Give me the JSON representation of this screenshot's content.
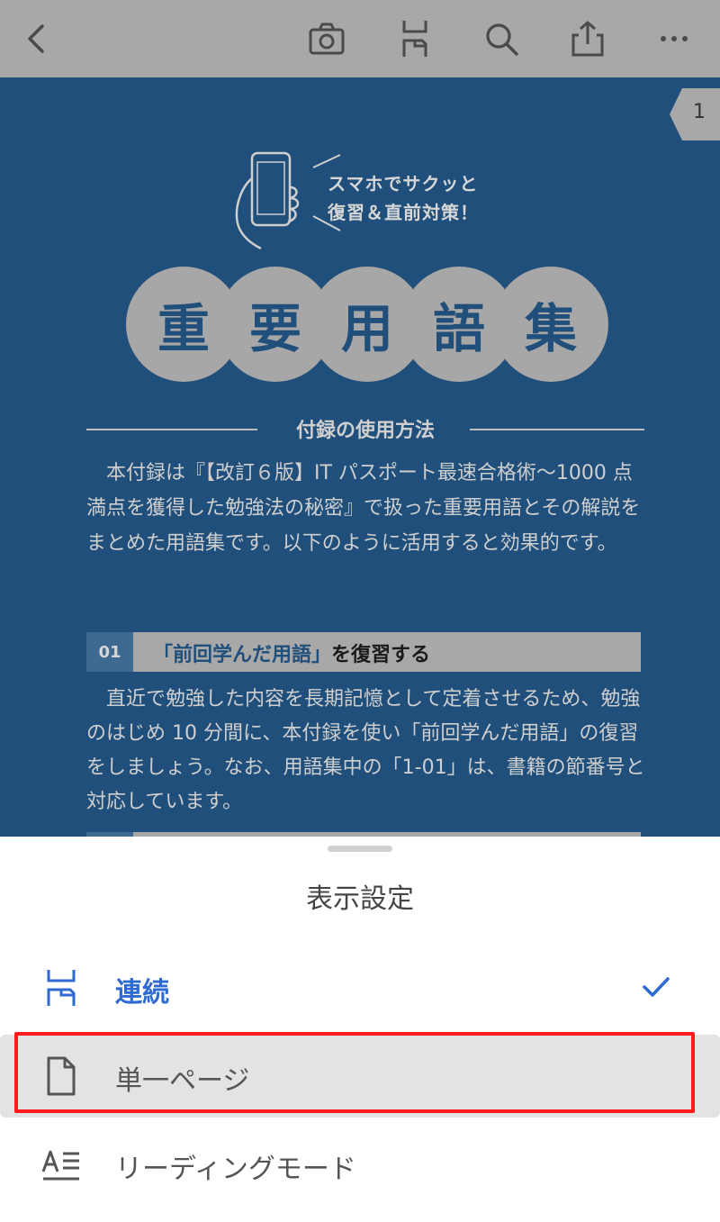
{
  "toolbar": {
    "back_icon": "chevron-left-icon",
    "camera_icon": "camera-icon",
    "scroll_mode_icon": "continuous-scroll-icon",
    "search_icon": "search-icon",
    "share_icon": "share-icon",
    "more_icon": "more-horizontal-icon"
  },
  "document": {
    "page_number": "1",
    "tagline_line1": "スマホでサクッと",
    "tagline_line2": "復習＆直前対策！",
    "title_chars": [
      "重",
      "要",
      "用",
      "語",
      "集"
    ],
    "usage_heading": "付録の使用方法",
    "intro_text": "本付録は『【改訂６版】IT パスポート最速合格術～1000 点満点を獲得した勉強法の秘密』で扱った重要用語とその解説をまとめた用語集です。以下のように活用すると効果的です。",
    "section_number": "01",
    "section_title_highlight": "「前回学んだ用語」",
    "section_title_rest": "を復習する",
    "section_body": "直近で勉強した内容を長期記憶として定着させるため、勉強のはじめ 10 分間に、本付録を使い「前回学んだ用語」の復習をしましょう。なお、用語集中の「1-01」は、書籍の節番号と対応しています。"
  },
  "sheet": {
    "title": "表示設定",
    "options": [
      {
        "label": "連続",
        "icon": "continuous-scroll-icon",
        "selected": true
      },
      {
        "label": "単一ページ",
        "icon": "single-page-icon",
        "selected": false
      },
      {
        "label": "リーディングモード",
        "icon": "reading-mode-icon",
        "selected": false
      }
    ],
    "check_icon": "checkmark-icon"
  },
  "colors": {
    "accent": "#2f6ad0",
    "doc_background": "#1f4f7a",
    "toolbar": "#a8a8a8",
    "highlight_border": "#ff1b1b"
  }
}
